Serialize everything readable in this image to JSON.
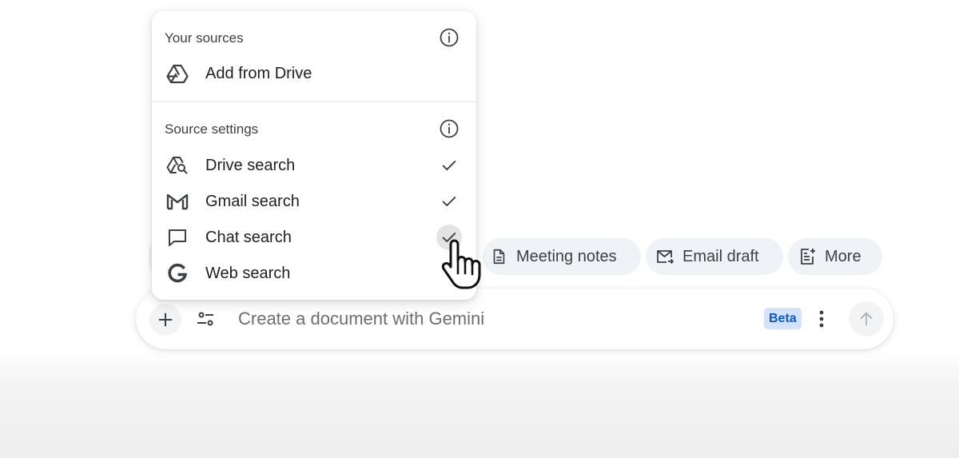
{
  "menu": {
    "your_sources_header": "Your sources",
    "add_from_drive_label": "Add from Drive",
    "source_settings_header": "Source settings",
    "items": [
      {
        "label": "Drive search",
        "icon": "drive-search-icon",
        "checked": true
      },
      {
        "label": "Gmail search",
        "icon": "gmail-icon",
        "checked": true
      },
      {
        "label": "Chat search",
        "icon": "chat-icon",
        "checked": true
      },
      {
        "label": "Web search",
        "icon": "google-icon",
        "checked": false
      }
    ]
  },
  "chips": {
    "meeting_notes": "Meeting notes",
    "email_draft": "Email draft",
    "more": "More"
  },
  "composer": {
    "placeholder": "Create a document with Gemini",
    "badge": "Beta"
  },
  "colors": {
    "badge_bg": "#d3e3fd",
    "badge_text": "#0b57d0",
    "chip_bg": "#eff2f7"
  }
}
